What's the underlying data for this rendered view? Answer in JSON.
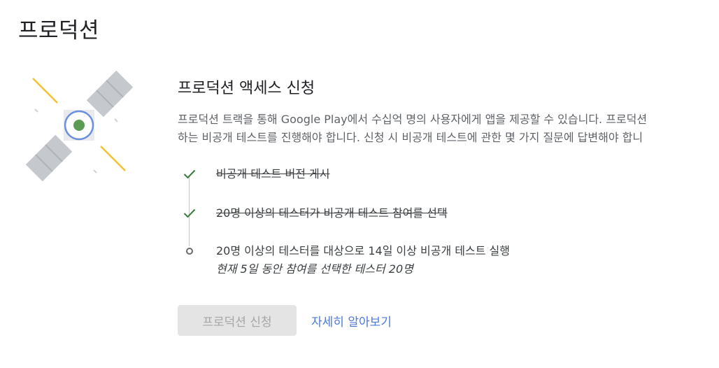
{
  "page": {
    "title": "프로덕션"
  },
  "content": {
    "heading": "프로덕션 액세스 신청",
    "description_line1": "프로덕션 트랙을 통해 Google Play에서 수십억 명의 사용자에게 앱을 제공할 수 있습니다. 프로덕션",
    "description_line2": "하는 비공개 테스트를 진행해야 합니다. 신청 시 비공개 테스트에 관한 몇 가지 질문에 답변해야 합니"
  },
  "checklist": {
    "steps": [
      {
        "label": "비공개 테스트 버전 게시",
        "status": "done"
      },
      {
        "label": "20명 이상의 테스터가 비공개 테스트 참여를 선택",
        "status": "done"
      },
      {
        "label": "20명 이상의 테스터를 대상으로 14일 이상 비공개 테스트 실행",
        "sublabel": "현재 5일 동안 참여를 선택한 테스터 20명",
        "status": "pending"
      }
    ]
  },
  "actions": {
    "apply_label": "프로덕션 신청",
    "learn_more_label": "자세히 알아보기"
  },
  "colors": {
    "check": "#3b7d3e",
    "link": "#4f79d6",
    "satellite_body": "#c5c9ce",
    "satellite_core": "#5a9c56",
    "satellite_ring": "#6b8fe0",
    "rays": "#f1c232"
  }
}
